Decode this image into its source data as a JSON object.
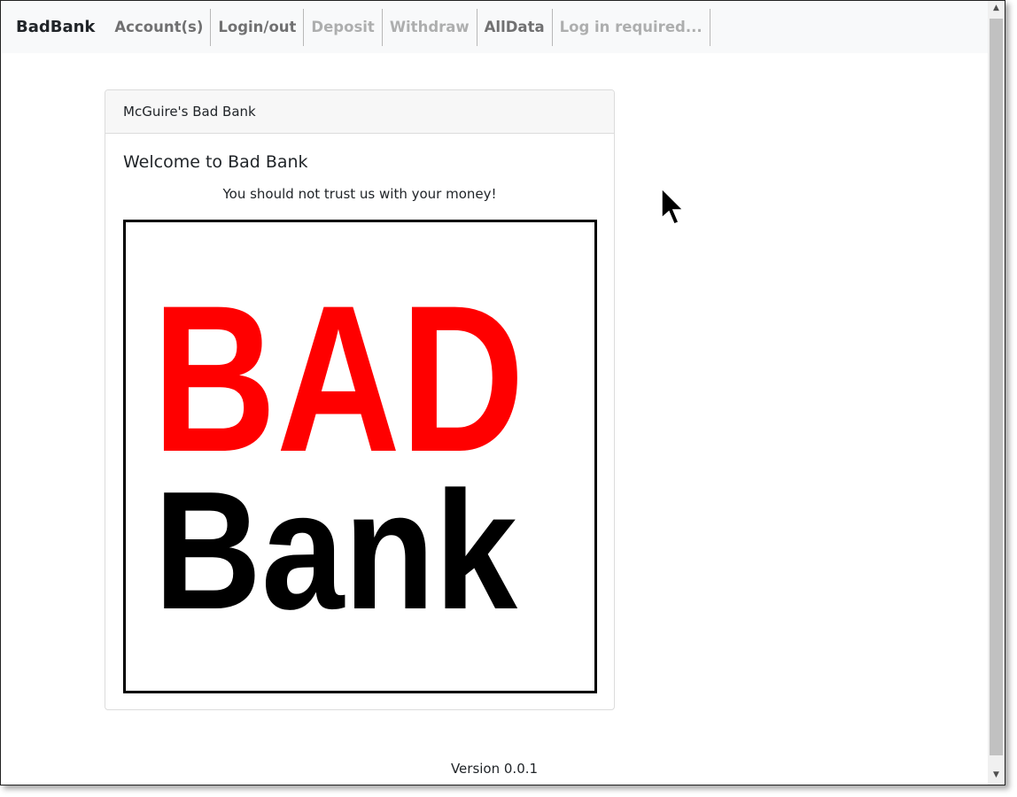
{
  "navbar": {
    "brand": "BadBank",
    "items": [
      {
        "label": "Account(s)",
        "enabled": true
      },
      {
        "label": "Login/out",
        "enabled": true
      },
      {
        "label": "Deposit",
        "enabled": false
      },
      {
        "label": "Withdraw",
        "enabled": false
      },
      {
        "label": "AllData",
        "enabled": true
      },
      {
        "label": "Log in required...",
        "enabled": false
      }
    ]
  },
  "card": {
    "header": "McGuire's Bad Bank",
    "title": "Welcome to Bad Bank",
    "text": "You should not trust us with your money!",
    "logo": {
      "line1": "BAD",
      "line2": "Bank",
      "line1_color": "#ff0000",
      "line2_color": "#000000"
    }
  },
  "footer": {
    "version": "Version 0.0.1"
  },
  "icons": {
    "cursor": "mouse-pointer-icon",
    "scroll_up": "triangle-up-icon",
    "scroll_down": "triangle-down-icon"
  }
}
